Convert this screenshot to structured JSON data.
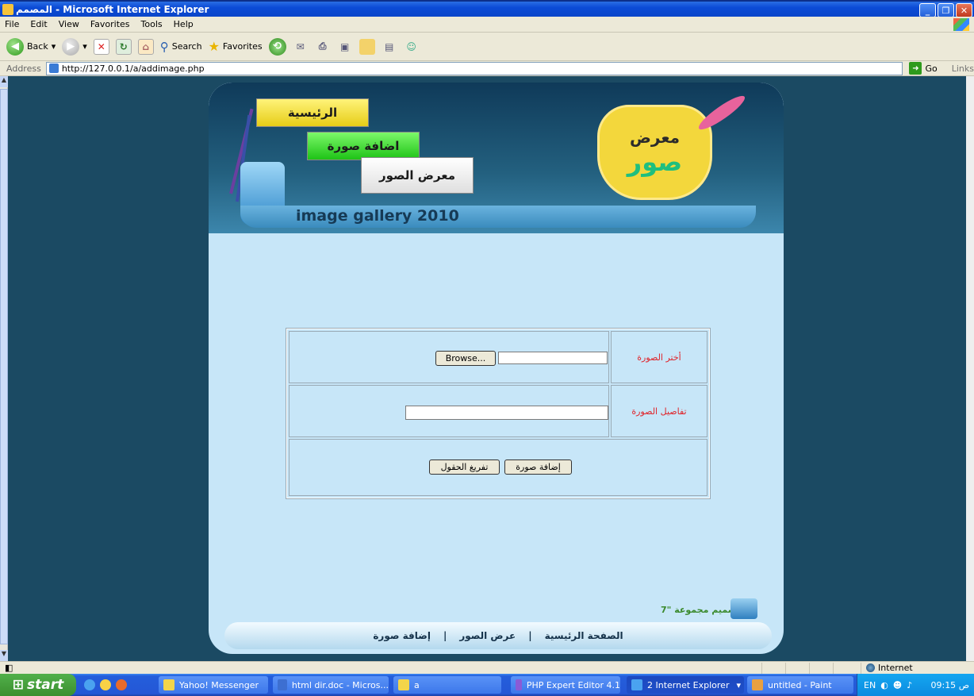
{
  "window": {
    "title": "المصمم - Microsoft Internet Explorer"
  },
  "menu": [
    "File",
    "Edit",
    "View",
    "Favorites",
    "Tools",
    "Help"
  ],
  "toolbar": {
    "back": "Back",
    "search": "Search",
    "favorites": "Favorites"
  },
  "address": {
    "label": "Address",
    "url": "http://127.0.0.1/a/addimage.php",
    "go": "Go",
    "links": "Links"
  },
  "site": {
    "nav_home": "الرئيسية",
    "nav_add": "اضافة صورة",
    "nav_view": "معرض الصور",
    "logo_top": "معرض",
    "logo_bottom": "صور",
    "banner": "image gallery 2010"
  },
  "form": {
    "choose_label": "أختر الصورة",
    "browse": "Browse...",
    "details_label": "تفاصيل الصورة",
    "submit": "إضافة صورة",
    "reset": "تفريغ الحقول",
    "file_value": "",
    "details_value": ""
  },
  "credit": "تصميم مجموعة \"7\"",
  "footer": {
    "home": "الصفحة الرئيسية",
    "sep": "|",
    "view": "عرض الصور",
    "add": "إضافة صورة"
  },
  "status": {
    "zone": "Internet"
  },
  "taskbar": {
    "start": "start",
    "tasks": [
      "Yahoo! Messenger",
      "html dir.doc - Micros...",
      "a",
      "PHP Expert Editor 4.1",
      "2 Internet Explorer",
      "untitled - Paint"
    ],
    "lang": "EN",
    "clock": "09:15 ص"
  }
}
